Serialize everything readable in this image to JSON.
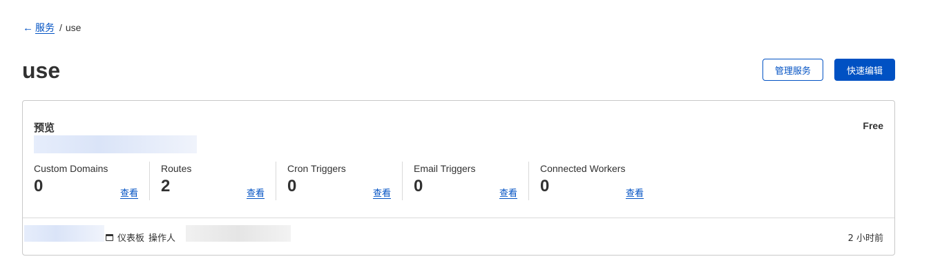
{
  "breadcrumb": {
    "back_arrow": "←",
    "back_label": "服务",
    "separator": "/",
    "current": "use"
  },
  "page": {
    "title": "use"
  },
  "actions": {
    "manage_label": "管理服务",
    "quick_edit_label": "快速编辑"
  },
  "overview": {
    "heading": "预览",
    "plan": "Free",
    "stats": [
      {
        "label": "Custom Domains",
        "value": "0",
        "link": "查看"
      },
      {
        "label": "Routes",
        "value": "2",
        "link": "查看"
      },
      {
        "label": "Cron Triggers",
        "value": "0",
        "link": "查看"
      },
      {
        "label": "Email Triggers",
        "value": "0",
        "link": "查看"
      },
      {
        "label": "Connected Workers",
        "value": "0",
        "link": "查看"
      }
    ],
    "footer": {
      "source": "仪表板",
      "actor_label": "操作人",
      "time": "2 小时前"
    }
  },
  "colors": {
    "link": "#0051c3",
    "primary": "#0051c3",
    "text": "#313131",
    "border": "#c8c8c8"
  }
}
